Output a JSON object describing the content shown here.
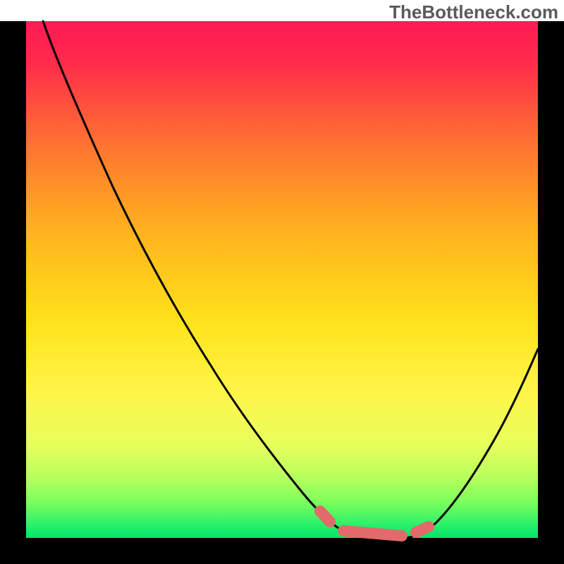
{
  "watermark": "TheBottleneck.com",
  "chart_data": {
    "type": "line",
    "title": "",
    "xlabel": "",
    "ylabel": "",
    "xlim": [
      0,
      100
    ],
    "ylim": [
      0,
      100
    ],
    "note": "Axes are unlabeled in the image. x is estimated normalized horizontal position (0–100); y is estimated normalized distance-from-optimum (0 at bottom, 100 at top). The plot depicts a V-shaped bottleneck curve with the minimum (green zone) around x≈68 and a secondary rise toward x=100.",
    "series": [
      {
        "name": "bottleneck-curve",
        "x": [
          0,
          5,
          10,
          15,
          20,
          25,
          30,
          35,
          40,
          45,
          50,
          55,
          57,
          60,
          63,
          66,
          69,
          72,
          75,
          78,
          82,
          86,
          90,
          94,
          98,
          100
        ],
        "y": [
          100,
          93,
          86,
          79,
          71,
          64,
          57,
          50,
          42,
          35,
          27,
          17,
          12,
          6,
          2,
          0,
          0,
          0,
          2,
          6,
          13,
          21,
          30,
          38,
          45,
          48
        ]
      },
      {
        "name": "optimum-markers",
        "x": [
          57,
          60,
          63,
          66,
          69,
          72,
          75
        ],
        "y": [
          12,
          6,
          2,
          0,
          0,
          0,
          2
        ]
      }
    ],
    "background_gradient": {
      "top": "#ff1a4d",
      "mid": "#ffd600",
      "bottom": "#00e64d"
    },
    "plot_frame": true
  }
}
